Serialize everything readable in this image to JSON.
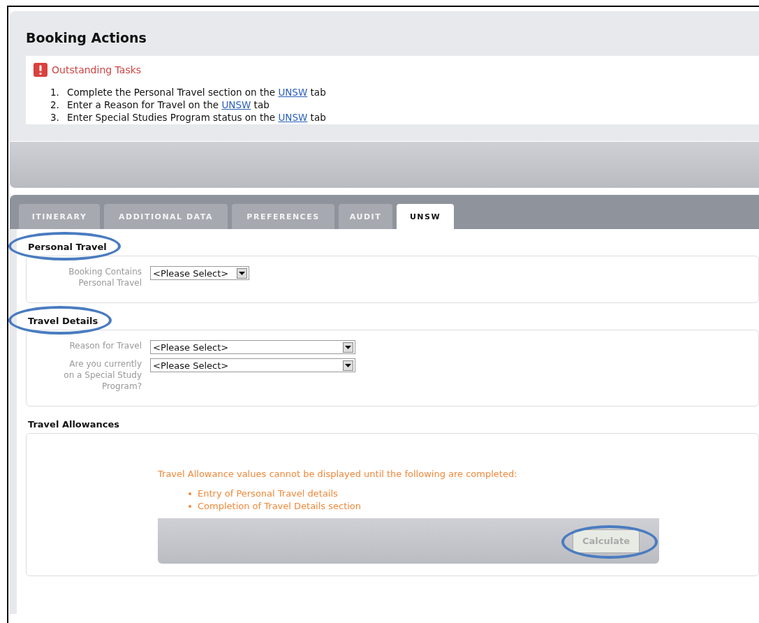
{
  "page_title": "Booking Actions",
  "outstanding": {
    "title": "Outstanding Tasks",
    "tasks": [
      {
        "number": "1.",
        "before": "Complete the Personal Travel section on the",
        "link": "UNSW",
        "after": "tab"
      },
      {
        "number": "2.",
        "before": "Enter a Reason for Travel on the",
        "link": "UNSW",
        "after": "tab"
      },
      {
        "number": "3.",
        "before": "Enter Special Studies Program status on the",
        "link": "UNSW",
        "after": "tab"
      }
    ]
  },
  "tabs": [
    {
      "label": "ITINERARY",
      "selected": false
    },
    {
      "label": "ADDITIONAL DATA",
      "selected": false
    },
    {
      "label": "PREFERENCES",
      "selected": false
    },
    {
      "label": "AUDIT",
      "selected": false
    },
    {
      "label": "UNSW",
      "selected": true
    }
  ],
  "sections": [
    {
      "title": "Personal Travel",
      "circled": true,
      "fields": [
        {
          "label": "Booking Contains Personal Travel",
          "value": "<Please Select>",
          "kind": "short"
        }
      ]
    },
    {
      "title": "Travel Details",
      "circled": true,
      "fields": [
        {
          "label": "Reason for Travel",
          "value": "<Please Select>",
          "kind": "long"
        },
        {
          "label": "Are you currently on a Special Study Program?",
          "value": "<Please Select>",
          "kind": "long"
        }
      ]
    }
  ],
  "allowances": {
    "title": "Travel Allowances",
    "message": "Travel Allowance values cannot be displayed until the following are completed:",
    "items": [
      "Entry of Personal Travel details",
      "Completion of Travel Details section"
    ],
    "button": {
      "label": "Calculate",
      "disabled": true,
      "circled": true
    }
  }
}
